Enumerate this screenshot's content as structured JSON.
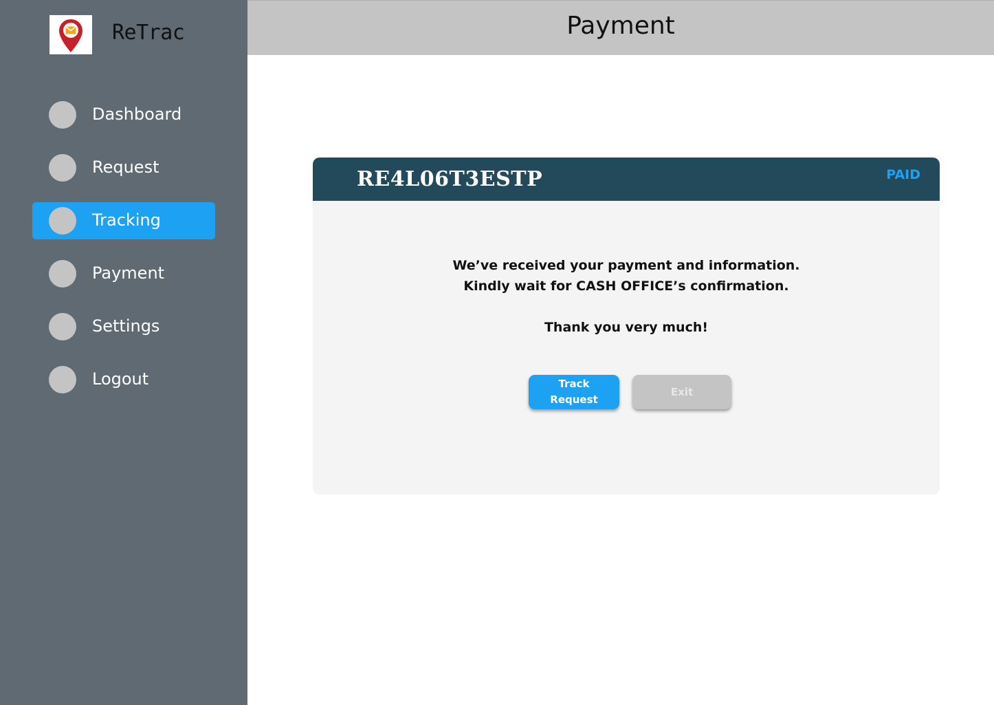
{
  "app": {
    "name": "ReTrac"
  },
  "sidebar": {
    "items": [
      {
        "label": "Dashboard"
      },
      {
        "label": "Request"
      },
      {
        "label": "Tracking",
        "active": true
      },
      {
        "label": "Payment"
      },
      {
        "label": "Settings"
      },
      {
        "label": "Logout"
      }
    ]
  },
  "header": {
    "title": "Payment"
  },
  "card": {
    "reference": "RE4L06T3ESTP",
    "status": "PAID",
    "message_line1": "We’ve received your payment and information.",
    "message_line2": "Kindly wait  for CASH OFFICE’s confirmation.",
    "thanks": "Thank you very much!",
    "track_button_line1": "Track",
    "track_button_line2": "Request",
    "exit_button": "Exit"
  },
  "colors": {
    "sidebar_bg": "#5f6a72",
    "accent": "#1da1f2",
    "card_header": "#234a5a",
    "header_bg": "#c4c4c4"
  },
  "icons": {
    "logo": "map-pin-envelope-icon"
  }
}
